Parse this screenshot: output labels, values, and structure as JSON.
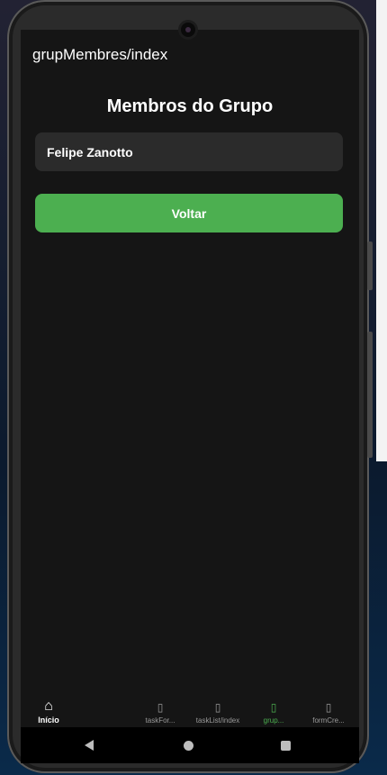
{
  "header": {
    "title": "grupMembres/index"
  },
  "page": {
    "title": "Membros do Grupo"
  },
  "members": [
    {
      "name": "Felipe Zanotto"
    }
  ],
  "actions": {
    "back_label": "Voltar"
  },
  "tabs": [
    {
      "label": "Início",
      "icon": "home-icon",
      "glyph": "⌂"
    },
    {
      "label": "taskFor...",
      "icon": "missing-glyph-icon",
      "glyph": "▯"
    },
    {
      "label": "taskList/index",
      "icon": "missing-glyph-icon",
      "glyph": "▯"
    },
    {
      "label": "grup...",
      "icon": "missing-glyph-icon",
      "glyph": "▯"
    },
    {
      "label": "formCre...",
      "icon": "missing-glyph-icon",
      "glyph": "▯"
    }
  ],
  "colors": {
    "accent": "#4caf50",
    "background": "#151515",
    "card": "#2b2b2b"
  }
}
